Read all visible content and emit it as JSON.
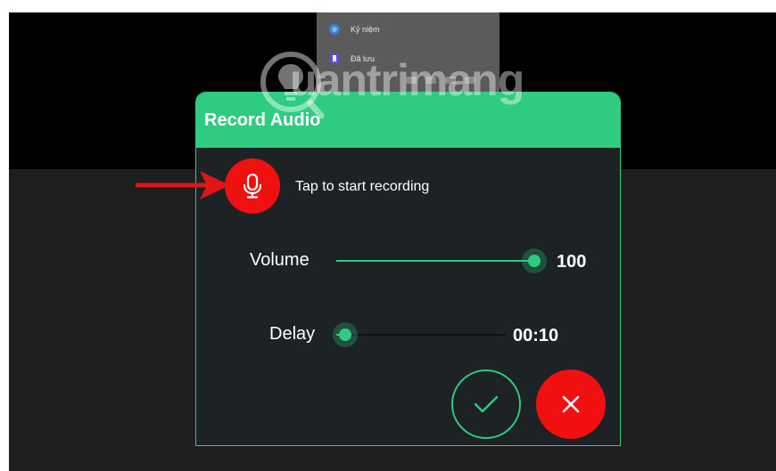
{
  "context_menu": {
    "items": [
      {
        "label": "Kỷ niệm",
        "icon": "globe-icon"
      },
      {
        "label": "Đã lưu",
        "icon": "bookmark-icon"
      }
    ]
  },
  "watermark": {
    "text": "uantrimang",
    "icon": "lightbulb-icon"
  },
  "dialog": {
    "title": "Record Audio",
    "record": {
      "hint": "Tap to start recording",
      "icon": "microphone-icon"
    },
    "volume": {
      "label": "Volume",
      "value": "100",
      "level_percent": 100
    },
    "delay": {
      "label": "Delay",
      "value": "00:10",
      "level_percent": 5
    },
    "confirm_icon": "checkmark-icon",
    "cancel_icon": "close-icon"
  },
  "colors": {
    "accent": "#2ecc80",
    "danger": "#f01010",
    "dialog_bg": "#1d2224",
    "annotation_arrow": "#e01515"
  }
}
